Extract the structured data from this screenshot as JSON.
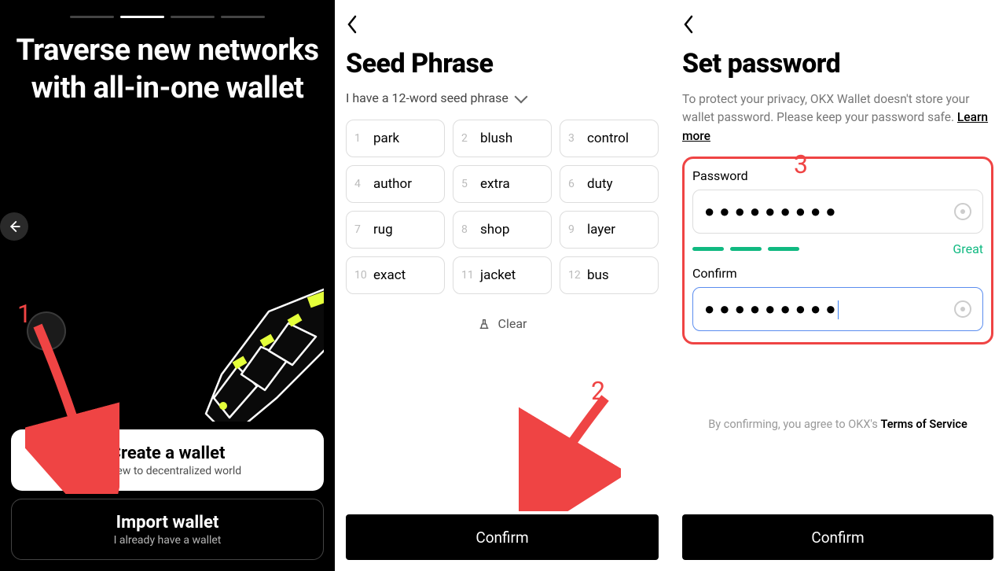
{
  "s1": {
    "title": "Traverse new networks with all-in-one wallet",
    "create": {
      "title": "Create a wallet",
      "sub": "I'm new to decentralized world"
    },
    "import": {
      "title": "Import wallet",
      "sub": "I already have a wallet"
    }
  },
  "s2": {
    "title": "Seed Phrase",
    "type_label": "I have a 12-word seed phrase",
    "words": [
      "park",
      "blush",
      "control",
      "author",
      "extra",
      "duty",
      "rug",
      "shop",
      "layer",
      "exact",
      "jacket",
      "bus"
    ],
    "clear": "Clear",
    "confirm": "Confirm"
  },
  "s3": {
    "title": "Set password",
    "desc_pre": "To protect your privacy, OKX Wallet doesn't store your wallet password. Please keep your password safe.  ",
    "learn": "Learn more",
    "pw_label": "Password",
    "confirm_label": "Confirm",
    "pw_mask": "●●●●●●●●●",
    "pw_mask2": "●●●●●●●●●",
    "strength": "Great",
    "tos_pre": "By confirming, you agree to OKX's ",
    "tos_link": "Terms of Service",
    "confirm_btn": "Confirm"
  },
  "anno": {
    "n1": "1",
    "n2": "2",
    "n3": "3"
  }
}
